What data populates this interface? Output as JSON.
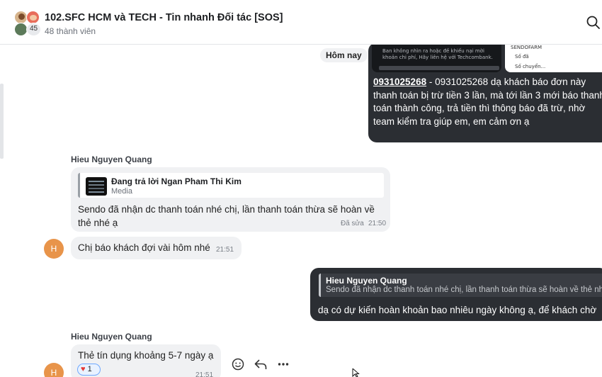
{
  "header": {
    "title": "102.SFC HCM và TECH - Tin nhanh Đối tác [SOS]",
    "member_count_badge": "45",
    "subtitle": "48 thành viên",
    "search_icon": "search-icon"
  },
  "chat": {
    "date_chip": "Hôm nay",
    "msg1": {
      "thumb1_text": [
        "Ban không nhìn ra hoặc đề khiếu nại mời",
        "khoản chi phí, Hãy liên hệ với Techcombank."
      ],
      "thumb2_text": [
        "SENDOFARM",
        "Số đã",
        "Số chuyển..."
      ],
      "phone": "0931025268",
      "text": " - 0931025268 dạ khách báo  đơn này thanh toán bị trừ tiền 3 lần, mà tới lần 3 mới báo thanh toán thành công, trả tiền thì thông báo đã trừ, nhờ team kiểm tra giúp em, em cảm ơn ạ"
    },
    "msg2": {
      "sender": "Hieu Nguyen Quang",
      "reply_title": "Đang trả lời Ngan Pham Thi Kim",
      "reply_sub": "Media",
      "text": "Sendo đã nhận dc thanh toán nhé chị, lần thanh toán thừa sẽ hoàn về thẻ nhé ạ",
      "edited": "Đã sửa",
      "time": "21:50"
    },
    "msg3": {
      "avatar_letter": "H",
      "text": "Chị báo khách đợi vài hôm nhé",
      "time": "21:51"
    },
    "msg4": {
      "reply_title": "Hieu Nguyen Quang",
      "reply_sub": "Sendo đã nhận dc thanh toán nhé chị, lần thanh toán thừa sẽ hoàn về thẻ nhé ạ",
      "text": "dạ có dự kiến hoàn khoản bao nhiêu ngày không ạ, để  khách chờ"
    },
    "msg5": {
      "sender": "Hieu Nguyen Quang",
      "avatar_letter": "H",
      "text": "Thẻ tín dụng khoảng 5-7 ngày ạ",
      "reaction_count": "1",
      "time": "21:51"
    },
    "actions": [
      "emoji-icon",
      "reply-icon",
      "more-icon"
    ]
  }
}
